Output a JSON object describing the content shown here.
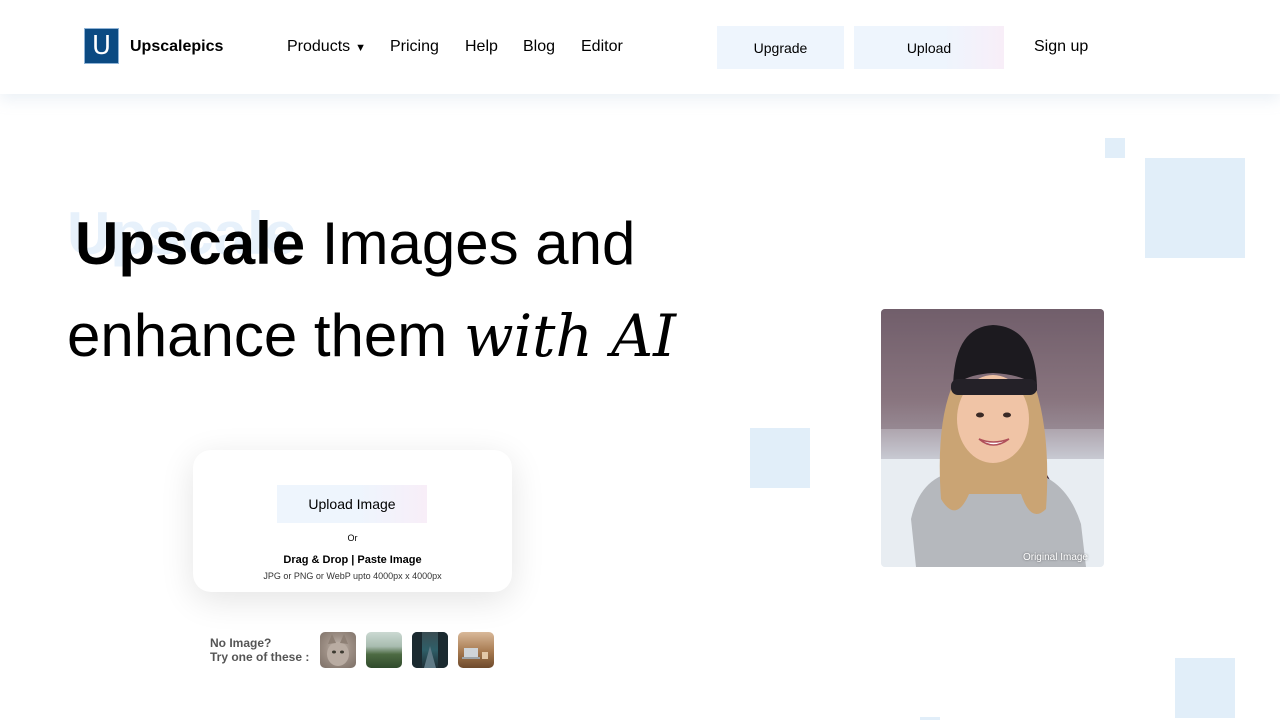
{
  "header": {
    "logo_letter": "U",
    "brand": "Upscalepics",
    "nav": {
      "products": "Products",
      "products_caret": "▼",
      "pricing": "Pricing",
      "help": "Help",
      "blog": "Blog",
      "editor": "Editor"
    },
    "upgrade_label": "Upgrade",
    "upload_label": "Upload",
    "signup_label": "Sign up"
  },
  "hero": {
    "bold_word": "Upscale",
    "line1_rest": " Images and",
    "line2_start": "enhance them ",
    "line2_script": "with AI"
  },
  "upload_card": {
    "button_label": "Upload Image",
    "or_text": "Or",
    "drag_text": "Drag & Drop | Paste Image",
    "hint_text": "JPG or PNG or WebP upto 4000px x 4000px"
  },
  "samples": {
    "label_line1": "No Image?",
    "label_line2": "Try one of these :"
  },
  "preview": {
    "caption": "Original Image"
  },
  "colors": {
    "accent_light": "#e1eef9",
    "logo_blue": "#0b4a82"
  }
}
